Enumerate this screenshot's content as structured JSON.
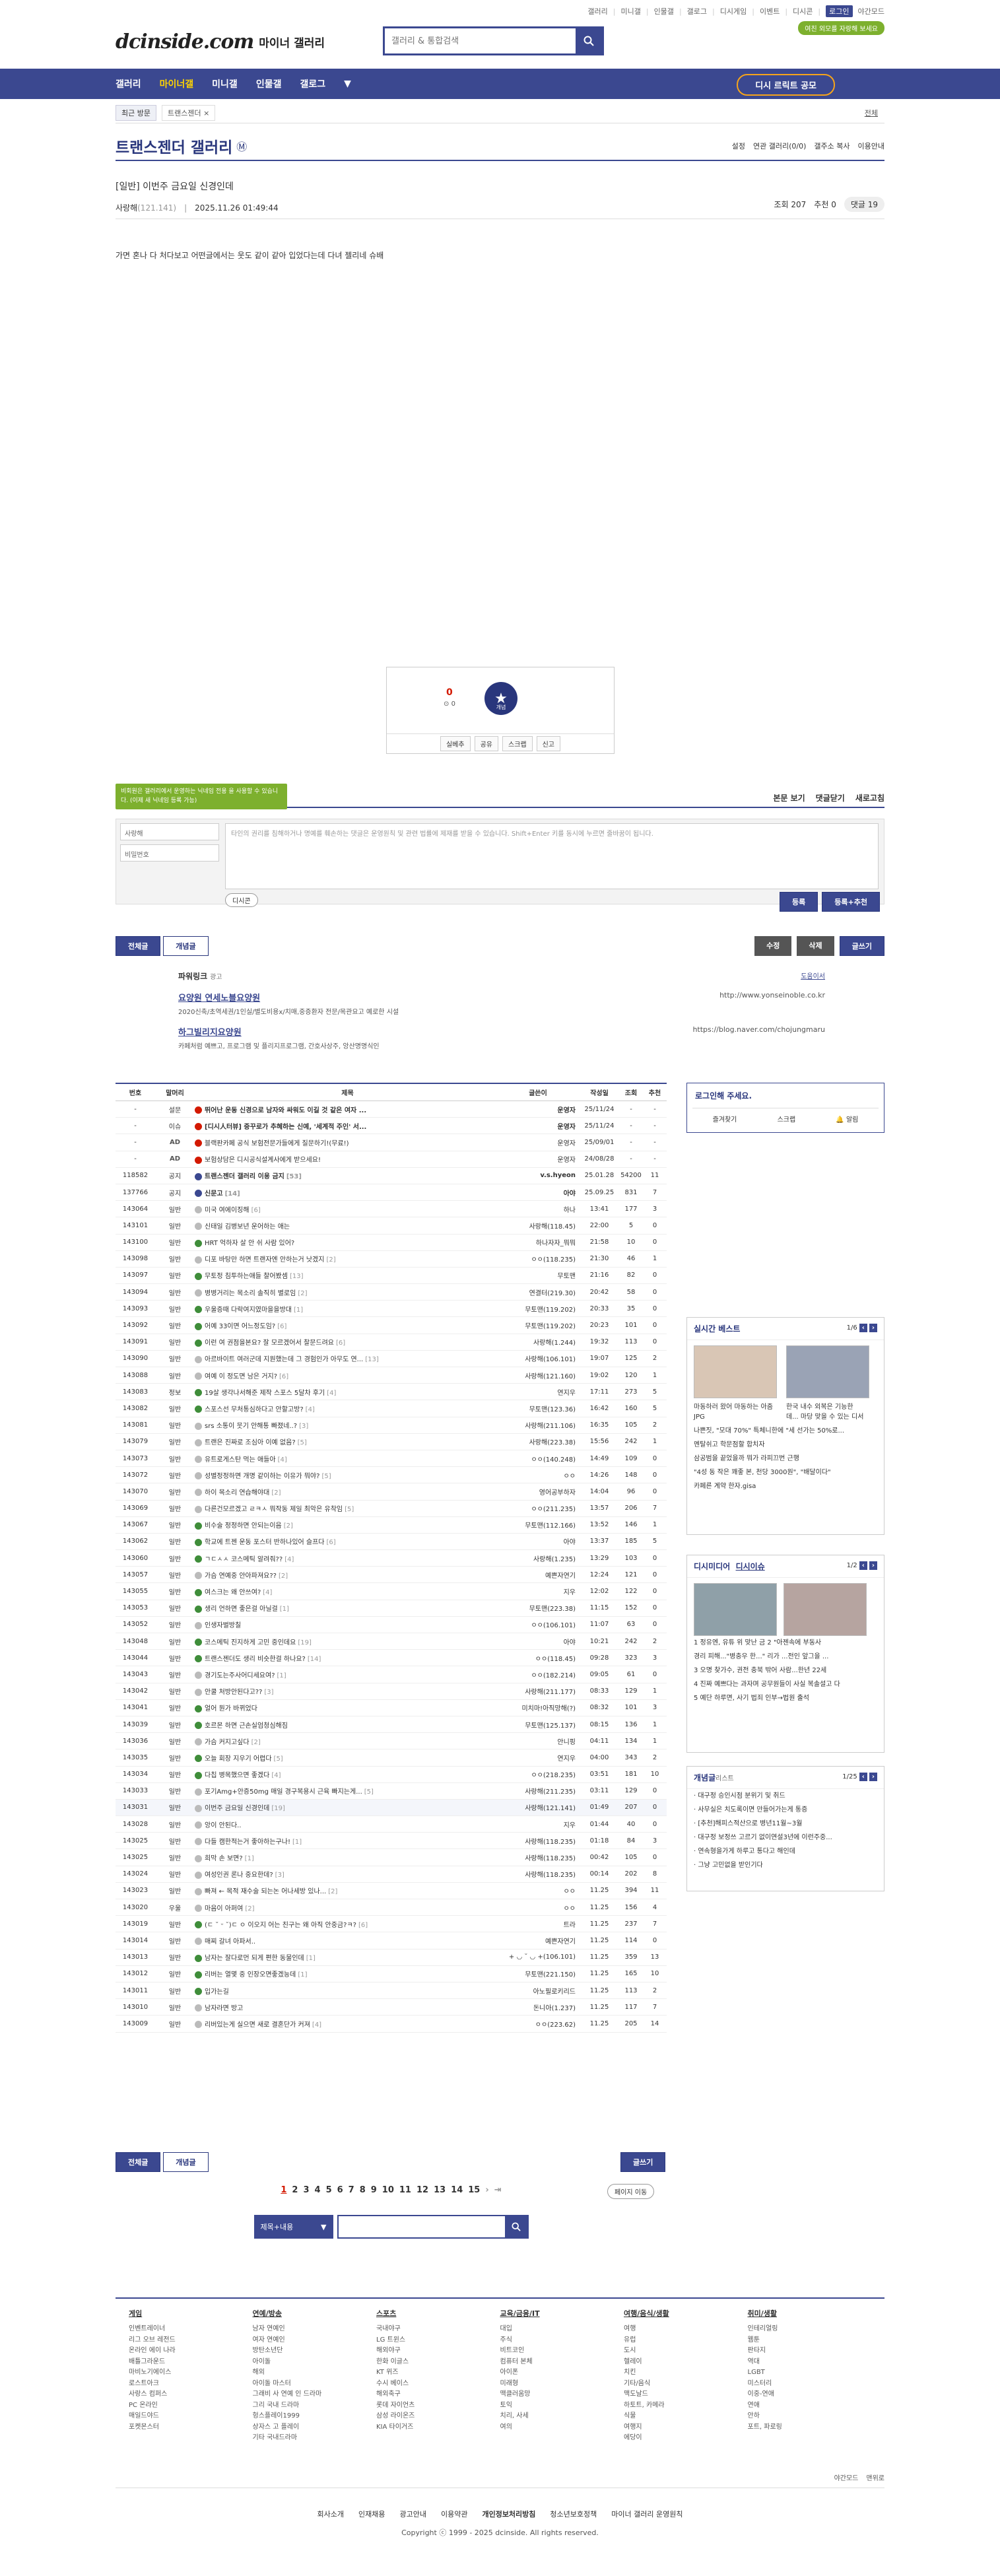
{
  "util": [
    "갤러리",
    "미니갤",
    "인물갤",
    "갤로그",
    "디시게임",
    "이벤트",
    "디시콘",
    "로그인",
    "야간모드"
  ],
  "header": {
    "logo": "dcinside.com",
    "sub": "마이너 갤러리",
    "search_placeholder": "갤러리 & 통합검색",
    "notice": "여친 외모를 자랑해 보세요"
  },
  "nav": {
    "items": [
      "갤러리",
      "마이너갤",
      "미니갤",
      "인물갤",
      "갤로그"
    ],
    "cta": "디시 르릭트 공모"
  },
  "recent": {
    "label": "최근 방문",
    "chip": "트랜스젠더 ×",
    "all": "전체"
  },
  "gallery": {
    "title": "트랜스젠더 갤러리",
    "right": [
      "설정",
      "연관 갤러리(0/0)",
      "갤주소 복사",
      "이용안내"
    ]
  },
  "post": {
    "title": "[일반] 이번주 금요일 신경인데",
    "writer": "사랑해",
    "ip": "(121.141)",
    "date": "2025.11.26 01:49:44",
    "views": "조회 207",
    "recommend": "추천 0",
    "replies": "댓글 19",
    "body": "가면 혼나 다 처다보고 어떤글에서는 웃도 같이 같아 입었다는데 다녀 젤리네 슈배"
  },
  "rec": {
    "num": "0",
    "sub": "0",
    "star": "개념",
    "btns": [
      "실베추",
      "공유",
      "스크랩",
      "신고"
    ]
  },
  "comment": {
    "tooltip": "비회원은 갤러리에서 운영하는 닉네임 전용 을 사용할 수 있습니다. (이제 새 닉네임 등록 가능)",
    "bar": [
      "본문 보기",
      "댓글닫기",
      "새로고침"
    ],
    "nick": "사랑해",
    "pw": "비밀번호",
    "placeholder": "타인의 권리를 침해하거나 명예를 훼손하는 댓글은 운영원칙 및 관련 법률에 제재를 받을 수 있습니다. Shift+Enter 키를 동시에 누르면 줄바꿈이 됩니다.",
    "dccon": "디시콘",
    "submit": "등록",
    "submit2": "등록+추천"
  },
  "post_btns": {
    "all": "전체글",
    "concept": "개념글",
    "edit": "수정",
    "delete": "삭제",
    "write": "글쓰기"
  },
  "power": {
    "head": "파워링크",
    "ad": "광고",
    "open": "도움이서",
    "items": [
      {
        "t": "요양원 연세노블요양원",
        "d": "2020신축/초역세권/1인실/별도비용x/치매,중증환자 전문/목관요고 예로한 시설",
        "u": "http://www.yonseinoble.co.kr"
      },
      {
        "t": "하그빌리지요양원",
        "d": "카페처럼 예쁘고, 프로그램 및 플리지프로그램, 간호사상주, 앙산명명식인",
        "u": "https://blog.naver.com/chojungmaru"
      }
    ]
  },
  "list": {
    "head": [
      "번호",
      "말머리",
      "제목",
      "글쓴이",
      "작성일",
      "조회",
      "추천"
    ],
    "rows": [
      {
        "n": "-",
        "s": "설문",
        "t": "뛰어난 운동 신경으로 남자와 싸워도 이길 것 같은 여자 ...",
        "w": "운영자",
        "d": "25/11/24",
        "v": "-",
        "r": "-",
        "k": "notice",
        "i": "red"
      },
      {
        "n": "-",
        "s": "이슈",
        "t": "[디시人터뷰] 중꾸로가 추혜하는 신예, '세계적 주인' 서...",
        "w": "운영자",
        "d": "25/11/24",
        "v": "-",
        "r": "-",
        "k": "notice",
        "i": "red"
      },
      {
        "n": "-",
        "s": "AD",
        "t": "블랙판카페 공식 보험전문가들에게 질문하기!(무료!)",
        "w": "운영자",
        "d": "25/09/01",
        "v": "-",
        "r": "-",
        "k": "ad",
        "i": "red"
      },
      {
        "n": "-",
        "s": "AD",
        "t": "보험상담은 디시공식설계사에게 받으세요!",
        "w": "운영자",
        "d": "24/08/28",
        "v": "-",
        "r": "-",
        "k": "ad",
        "i": "red"
      },
      {
        "n": "118582",
        "s": "공지",
        "t": "트랜스젠더 갤러리 이용 금지",
        "c": "[53]",
        "w": "v.s.hyeon",
        "d": "25.01.28",
        "v": "54200",
        "r": "11",
        "k": "notice",
        "i": "blue"
      },
      {
        "n": "137766",
        "s": "공지",
        "t": "신문고",
        "c": "[14]",
        "w": "아야",
        "d": "25.09.25",
        "v": "831",
        "r": "7",
        "k": "notice",
        "i": "blue"
      },
      {
        "n": "143064",
        "s": "일반",
        "t": "미국 여에이징해",
        "c": "[6]",
        "w": "하나",
        "d": "13:41",
        "v": "177",
        "r": "3"
      },
      {
        "n": "143101",
        "s": "일반",
        "t": "신태일 김병보년 운어하는 애는",
        "w": "사랑해(118.45)",
        "d": "22:00",
        "v": "5",
        "r": "0"
      },
      {
        "n": "143100",
        "s": "일반",
        "t": "HRT 억하자 살 안 쉬 사람 있어?",
        "w": "하나자자_뭐뭐",
        "d": "21:58",
        "v": "10",
        "r": "0",
        "i": "g"
      },
      {
        "n": "143098",
        "s": "일반",
        "t": "디포 바탕만 하면 트랜자엔 안하는거 낫겠지",
        "c": "[2]",
        "w": "ㅇㅇ(118.235)",
        "d": "21:30",
        "v": "46",
        "r": "1"
      },
      {
        "n": "143097",
        "s": "일반",
        "t": "무토정 침투하는애들 찰어봤셈",
        "c": "[13]",
        "w": "무토맨",
        "d": "21:16",
        "v": "82",
        "r": "0",
        "i": "g"
      },
      {
        "n": "143094",
        "s": "일반",
        "t": "병병거리는 목소리 솔직히 별로임",
        "c": "[2]",
        "w": "연결터(219.30)",
        "d": "20:42",
        "v": "58",
        "r": "0"
      },
      {
        "n": "143093",
        "s": "일반",
        "t": "우울증때 다락여지였마을을방대",
        "c": "[1]",
        "w": "무토맨(119.202)",
        "d": "20:33",
        "v": "35",
        "r": "0",
        "i": "g"
      },
      {
        "n": "143092",
        "s": "일반",
        "t": "어예 33이면 어느정도임?",
        "c": "[6]",
        "w": "무토맨(119.202)",
        "d": "20:23",
        "v": "101",
        "r": "0",
        "i": "g"
      },
      {
        "n": "143091",
        "s": "일반",
        "t": "이런 여 권점을본요? 잘 모르겠어서 찰문드려요",
        "c": "[6]",
        "w": "사랑해(1.244)",
        "d": "19:32",
        "v": "113",
        "r": "0",
        "i": "g"
      },
      {
        "n": "143090",
        "s": "일반",
        "t": "아르바이트 여러군데 지원했는데 그 경험인가 아무도 연...",
        "c": "[13]",
        "w": "사랑해(106.101)",
        "d": "19:07",
        "v": "125",
        "r": "2"
      },
      {
        "n": "143088",
        "s": "일반",
        "t": "여예 이 정도면 남은 거지?",
        "c": "[6]",
        "w": "사랑해(121.160)",
        "d": "19:02",
        "v": "120",
        "r": "1"
      },
      {
        "n": "143083",
        "s": "정보",
        "t": "19살 생각나서해준 제작 스포스 5달차 후기",
        "c": "[4]",
        "w": "연지우",
        "d": "17:11",
        "v": "273",
        "r": "5",
        "i": "g"
      },
      {
        "n": "143082",
        "s": "일반",
        "t": "스포스선 무처통심하다고 안할고방?",
        "c": "[4]",
        "w": "무토맨(123.36)",
        "d": "16:42",
        "v": "160",
        "r": "5",
        "i": "g"
      },
      {
        "n": "143081",
        "s": "일반",
        "t": "srs 소통이 뭇기 안해통 빠졌네..?",
        "c": "[3]",
        "w": "사랑해(211.106)",
        "d": "16:35",
        "v": "105",
        "r": "2"
      },
      {
        "n": "143079",
        "s": "일반",
        "t": "트랜은 진짜로 조심아 이예 없음?",
        "c": "[5]",
        "w": "사랑해(223.38)",
        "d": "15:56",
        "v": "242",
        "r": "1"
      },
      {
        "n": "143073",
        "s": "일반",
        "t": "유트로게스탄 먹는 애들아",
        "c": "[4]",
        "w": "ㅇㅇ(140.248)",
        "d": "14:49",
        "v": "109",
        "r": "0"
      },
      {
        "n": "143072",
        "s": "일반",
        "t": "성별정정하면 개명 같이하는 이유가 뭐야?",
        "c": "[5]",
        "w": "ㅇㅇ",
        "d": "14:26",
        "v": "148",
        "r": "0"
      },
      {
        "n": "143070",
        "s": "일반",
        "t": "하이 목소리 연습해야대",
        "c": "[2]",
        "w": "영어공부하자",
        "d": "14:04",
        "v": "96",
        "r": "0"
      },
      {
        "n": "143069",
        "s": "일반",
        "t": "다른건모르겠고 ㄹㅋㅅ 뭐작동 제일 최악은 유착임",
        "c": "[5]",
        "w": "ㅇㅇ(211.235)",
        "d": "13:57",
        "v": "206",
        "r": "7"
      },
      {
        "n": "143067",
        "s": "일반",
        "t": "비수술 정정하면 안되는이음",
        "c": "[2]",
        "w": "무토맨(112.166)",
        "d": "13:52",
        "v": "146",
        "r": "1",
        "i": "g"
      },
      {
        "n": "143062",
        "s": "일반",
        "t": "학교에 트젠 운동 포스터 반하나있어 슬프다",
        "c": "[6]",
        "w": "아야",
        "d": "13:37",
        "v": "185",
        "r": "5",
        "i": "g"
      },
      {
        "n": "143060",
        "s": "일반",
        "t": "ㄱㄷㅅㅅ 코스메틱 알려줘??",
        "c": "[4]",
        "w": "사랑해(1.235)",
        "d": "13:29",
        "v": "103",
        "r": "0",
        "i": "g"
      },
      {
        "n": "143057",
        "s": "일반",
        "t": "가슴 연예중 안아파져요??",
        "c": "[2]",
        "w": "예쁜자연기",
        "d": "12:24",
        "v": "121",
        "r": "0"
      },
      {
        "n": "143055",
        "s": "일반",
        "t": "여스크는 왜 안쓰여?",
        "c": "[4]",
        "w": "지우",
        "d": "12:02",
        "v": "122",
        "r": "0",
        "i": "g"
      },
      {
        "n": "143053",
        "s": "일반",
        "t": "생리 언하면 좋은걸 아닐걸",
        "c": "[1]",
        "w": "무토맨(223.38)",
        "d": "11:15",
        "v": "152",
        "r": "0",
        "i": "g"
      },
      {
        "n": "143052",
        "s": "일반",
        "t": "인생자벌방칠",
        "w": "ㅇㅇ(106.101)",
        "d": "11:07",
        "v": "63",
        "r": "0"
      },
      {
        "n": "143048",
        "s": "일반",
        "t": "코스메틱 진지하게 고민 중인데요",
        "c": "[19]",
        "w": "아야",
        "d": "10:21",
        "v": "242",
        "r": "2",
        "i": "g"
      },
      {
        "n": "143044",
        "s": "일반",
        "t": "트랜스젠더도 생리 비슷한걸 하나요?",
        "c": "[14]",
        "w": "ㅇㅇ(118.45)",
        "d": "09:28",
        "v": "323",
        "r": "3",
        "i": "g"
      },
      {
        "n": "143043",
        "s": "일반",
        "t": "경기도는주사어디세요여?",
        "c": "[1]",
        "w": "ㅇㅇ(182.214)",
        "d": "09:05",
        "v": "61",
        "r": "0"
      },
      {
        "n": "143042",
        "s": "일반",
        "t": "안쿨 처방안된다고??",
        "c": "[3]",
        "w": "사랑해(211.177)",
        "d": "08:33",
        "v": "129",
        "r": "1"
      },
      {
        "n": "143041",
        "s": "일반",
        "t": "얼어 뭔가 바뀌었다",
        "w": "미치마!아직망해(?)",
        "d": "08:32",
        "v": "101",
        "r": "3",
        "i": "g"
      },
      {
        "n": "143039",
        "s": "일반",
        "t": "호르몬 하면 근손실엄청심해짐",
        "w": "무토맨(125.137)",
        "d": "08:15",
        "v": "136",
        "r": "1",
        "i": "g"
      },
      {
        "n": "143036",
        "s": "일반",
        "t": "가슴 커지고싶다",
        "c": "[2]",
        "w": "안니핑",
        "d": "04:11",
        "v": "134",
        "r": "1"
      },
      {
        "n": "143035",
        "s": "일반",
        "t": "오늘 회장 지우기 어렵다",
        "c": "[5]",
        "w": "연지우",
        "d": "04:00",
        "v": "343",
        "r": "2",
        "i": "g"
      },
      {
        "n": "143034",
        "s": "일반",
        "t": "다칩 병목했으면 좋겠다",
        "c": "[4]",
        "w": "ㅇㅇ(218.235)",
        "d": "03:51",
        "v": "181",
        "r": "10",
        "i": "g"
      },
      {
        "n": "143033",
        "s": "일반",
        "t": "포기Amg+안증50mg 매일 경구복용시 근육 빠지는게...",
        "c": "[5]",
        "w": "사랑해(211.235)",
        "d": "03:11",
        "v": "129",
        "r": "0"
      },
      {
        "n": "143031",
        "s": "일반",
        "t": "이번주 금요일 신경인데",
        "c": "[19]",
        "w": "사랑해(121.141)",
        "d": "01:49",
        "v": "207",
        "r": "0",
        "k": "cur"
      },
      {
        "n": "143028",
        "s": "일반",
        "t": "앙이 안된다..",
        "w": "지우",
        "d": "01:44",
        "v": "40",
        "r": "0"
      },
      {
        "n": "143025",
        "s": "일반",
        "t": "다들 캠한적는거 좋아하는구나!",
        "c": "[1]",
        "w": "사랑해(118.235)",
        "d": "01:18",
        "v": "84",
        "r": "3"
      },
      {
        "n": "143025",
        "s": "일반",
        "t": "희막 손 보면?",
        "c": "[1]",
        "w": "사랑해(118.235)",
        "d": "00:42",
        "v": "105",
        "r": "0"
      },
      {
        "n": "143024",
        "s": "일반",
        "t": "여성인권 론나 중요한데?",
        "c": "[3]",
        "w": "사랑해(118.235)",
        "d": "00:14",
        "v": "202",
        "r": "8"
      },
      {
        "n": "143023",
        "s": "일반",
        "t": "빠져 ← 목적 재수술 되는논 어나세방 있나...",
        "c": "[2]",
        "w": "ㅇㅇ",
        "d": "11.25",
        "v": "394",
        "r": "11"
      },
      {
        "n": "143020",
        "s": "우울",
        "t": "마음이 아퍼여",
        "c": "[2]",
        "w": "ㅇㅇ",
        "d": "11.25",
        "v": "156",
        "r": "4"
      },
      {
        "n": "143019",
        "s": "일반",
        "t": "(ㄷ ˘ ᵕ ˘)ㄷ ㅇ 이오지 어는 친구는 왜 아직 안중금?ㅋ?",
        "c": "[6]",
        "w": "트라",
        "d": "11.25",
        "v": "237",
        "r": "7",
        "i": "g"
      },
      {
        "n": "143014",
        "s": "일반",
        "t": "매찌 갈녀 아파서..",
        "w": "예쁜자연기",
        "d": "11.25",
        "v": "114",
        "r": "0"
      },
      {
        "n": "143013",
        "s": "일반",
        "t": "남자는 잘다로먼 되게 편한 동물인데",
        "c": "[1]",
        "w": "+ ◡ ˘ ◡ +(106.101)",
        "d": "11.25",
        "v": "359",
        "r": "13",
        "i": "g"
      },
      {
        "n": "143012",
        "s": "일반",
        "t": "리버는 열몇 중 인장오면좋겠능데",
        "c": "[1]",
        "w": "무토맨(221.150)",
        "d": "11.25",
        "v": "165",
        "r": "10",
        "i": "g"
      },
      {
        "n": "143011",
        "s": "일반",
        "t": "입가는길",
        "w": "아노필로키리드",
        "d": "11.25",
        "v": "113",
        "r": "2",
        "i": "g"
      },
      {
        "n": "143010",
        "s": "일반",
        "t": "남자라면 방고",
        "w": "돈니아(1.237)",
        "d": "11.25",
        "v": "117",
        "r": "7"
      },
      {
        "n": "143009",
        "s": "일반",
        "t": "리버있는게 실으면 새로 결혼단가 커져",
        "c": "[4]",
        "w": "ㅇㅇ(223.62)",
        "d": "11.25",
        "v": "205",
        "r": "14"
      }
    ]
  },
  "login": {
    "title": "로그인해 주세요.",
    "btns": [
      "즐겨찾기",
      "스크랩",
      "알림"
    ]
  },
  "best": {
    "title": "실시간 베스트",
    "page": "1/6",
    "items": [
      "마동하러 왔어 마동하는 아줌 JPG",
      "한국 내수 외복은 기능한 데... 마당 맞을 수 있는 디서"
    ],
    "list": [
      "나쁜짓, \"모대 70%\" 특체니한에 \"세 선가는 50%로...",
      "멘탈쉬고 학문점할 합치자",
      "삼공범을 끝었을까 뭐가 라피끄번 근행",
      "\"4성 동 작은 꽤좋 본, 천당 3000원\", \"배달이다\"",
      "카페른 계약 한자.gisa"
    ]
  },
  "issue": {
    "title": "디시미디어",
    "title2": "디시이슈",
    "page": "1/2",
    "list": [
      "1 정유엔, 유튜 위 맞난 금 2 \"아젠속에 부동사",
      "경리 피해...\"병충우 한...\"  리가 ...전인 앞그을 ...",
      "3 오명 찾가수, 권전 충북 밖어 사람...한년 22세",
      "4 진짜 예쁘다는 과자며 공무원들이 사실 복솔설고 다",
      "5 예단 하루면, 사기 법죄 인부→법원 출석"
    ]
  },
  "concept": {
    "title": "개념글",
    "sub": "리스트",
    "page": "1/25",
    "list": [
      "대구정 승인시점 분위기 및 취드",
      "사무실은 치도록이면 만들어가는게 통증",
      "[추천]해피스적산으로 병년11월~3월",
      "대구정 보정쓰 고르기 없이연설3년에 이런주중...",
      "연속형을가게 하루고 통다고 해인데",
      "그냥 고민없을 받인기다"
    ]
  },
  "bottom": {
    "jump": "페이지 이동",
    "select": "제목+내용",
    "pages": [
      "1",
      "2",
      "3",
      "4",
      "5",
      "6",
      "7",
      "8",
      "9",
      "10",
      "11",
      "12",
      "13",
      "14",
      "15"
    ]
  },
  "footer": {
    "cols": [
      {
        "h": "게임",
        "items": [
          "인벤트레이너",
          "리그 오브 레전드",
          "온라인 에이 나라",
          "배틀그라운드",
          "마비노기에이스",
          "로스트아크",
          "사랑스 컴퍼스",
          "PC 온라인",
          "매일드야드",
          "포켓몬스터"
        ]
      },
      {
        "h": "연예/방송",
        "items": [
          "남자 연예인",
          "여자 연예인",
          "방탄소년단",
          "아이돌",
          "해외",
          "아이돌 마스터",
          "그래비 사 연예 인 드라마",
          "그리 국내 드라마",
          "헝스플레이1999",
          "상자스 고 플레이",
          "기타 국내드라마"
        ]
      },
      {
        "h": "스포츠",
        "items": [
          "국내야구",
          "LG 트윈스",
          "해외야구",
          "한화 이글스",
          "KT 위즈",
          "수시 베이스",
          "해외축구",
          "롯데 자이언츠",
          "삼성 라이온즈",
          "KIA 타이거즈"
        ]
      },
      {
        "h": "교육/금융/IT",
        "items": [
          "대입",
          "주식",
          "비트코인",
          "컴퓨터 본체",
          "아이폰",
          "미래형",
          "맥클러움망",
          "토익",
          "치리, 사세",
          "여의"
        ]
      },
      {
        "h": "여행/음식/생활",
        "items": [
          "여행",
          "유럽",
          "도시",
          "헬레이",
          "치킨",
          "기타/음식",
          "맥도날드",
          "하토트, 카메라",
          "식물",
          "여행지",
          "에당이"
        ]
      },
      {
        "h": "취미/생활",
        "items": [
          "인테리얼링",
          "웹툰",
          "판타지",
          "역대",
          "LGBT",
          "미스터리",
          "이중-연애",
          "연애",
          "안하",
          "포트, 파로링"
        ]
      }
    ],
    "mini": [
      "야간모드",
      "맨위로"
    ],
    "links": [
      "회사소개",
      "인재채용",
      "광고안내",
      "이용약관",
      "개인정보처리방침",
      "청소년보호정책",
      "마이너 갤러리 운영원칙"
    ],
    "copy": "Copyright ⓒ 1999 - 2025 dcinside. All rights reserved."
  }
}
